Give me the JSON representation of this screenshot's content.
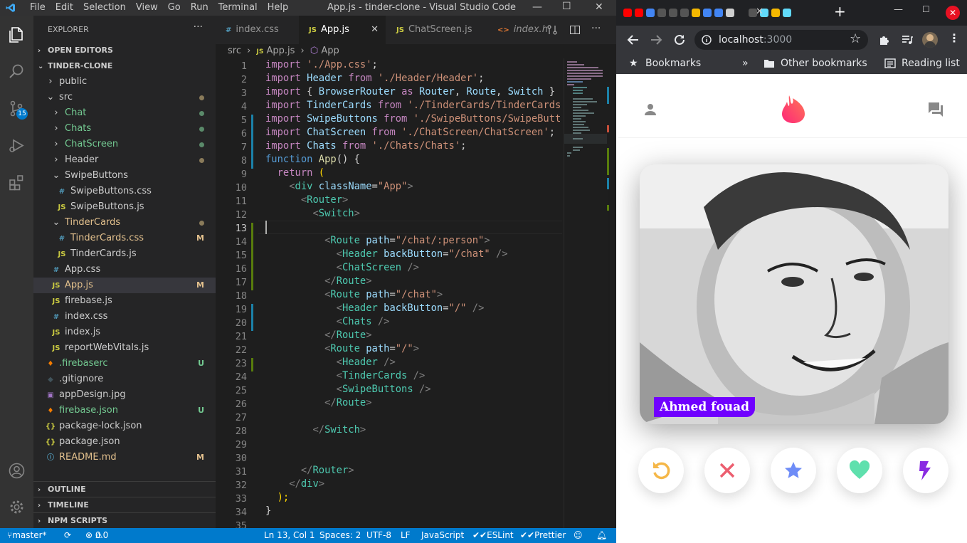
{
  "vscode": {
    "title": "App.js - tinder-clone - Visual Studio Code",
    "menu": [
      "File",
      "Edit",
      "Selection",
      "View",
      "Go",
      "Run",
      "Terminal",
      "Help"
    ],
    "activity_badge": "15",
    "explorer_header": "EXPLORER",
    "open_editors": "OPEN EDITORS",
    "project": "TINDER-CLONE",
    "tree": [
      {
        "label": "public",
        "kind": "folder",
        "indent": 1,
        "open": false
      },
      {
        "label": "src",
        "kind": "folder",
        "indent": 1,
        "open": true,
        "mark": "dot"
      },
      {
        "label": "Chat",
        "kind": "folder",
        "indent": 2,
        "open": false,
        "mark": "dot-green"
      },
      {
        "label": "Chats",
        "kind": "folder",
        "indent": 2,
        "open": false,
        "mark": "dot-green"
      },
      {
        "label": "ChatScreen",
        "kind": "folder",
        "indent": 2,
        "open": false,
        "mark": "dot-green"
      },
      {
        "label": "Header",
        "kind": "folder",
        "indent": 2,
        "open": false,
        "mark": "dot"
      },
      {
        "label": "SwipeButtons",
        "kind": "folder",
        "indent": 2,
        "open": true
      },
      {
        "label": "SwipeButtons.css",
        "kind": "css",
        "indent": 3
      },
      {
        "label": "SwipeButtons.js",
        "kind": "js",
        "indent": 3
      },
      {
        "label": "TinderCards",
        "kind": "folder",
        "indent": 2,
        "open": true,
        "mark": "dot",
        "color": "#e2c08d"
      },
      {
        "label": "TinderCards.css",
        "kind": "css",
        "indent": 3,
        "badge": "M",
        "color": "#e2c08d"
      },
      {
        "label": "TinderCards.js",
        "kind": "js",
        "indent": 3
      },
      {
        "label": "App.css",
        "kind": "css",
        "indent": 2
      },
      {
        "label": "App.js",
        "kind": "js",
        "indent": 2,
        "badge": "M",
        "color": "#e2c08d",
        "selected": true
      },
      {
        "label": "firebase.js",
        "kind": "js",
        "indent": 2
      },
      {
        "label": "index.css",
        "kind": "css",
        "indent": 2
      },
      {
        "label": "index.js",
        "kind": "js",
        "indent": 2
      },
      {
        "label": "reportWebVitals.js",
        "kind": "js",
        "indent": 2
      },
      {
        "label": ".firebaserc",
        "kind": "fire",
        "indent": 1,
        "badge": "U",
        "color": "#73c991"
      },
      {
        "label": ".gitignore",
        "kind": "git",
        "indent": 1
      },
      {
        "label": "appDesign.jpg",
        "kind": "img",
        "indent": 1
      },
      {
        "label": "firebase.json",
        "kind": "fire",
        "indent": 1,
        "badge": "U",
        "color": "#73c991"
      },
      {
        "label": "package-lock.json",
        "kind": "json",
        "indent": 1
      },
      {
        "label": "package.json",
        "kind": "json",
        "indent": 1
      },
      {
        "label": "README.md",
        "kind": "md",
        "indent": 1,
        "badge": "M",
        "color": "#e2c08d"
      }
    ],
    "outline": "OUTLINE",
    "timeline": "TIMELINE",
    "npm_scripts": "NPM SCRIPTS",
    "tabs": [
      {
        "label": "index.css",
        "icon": "#",
        "active": false
      },
      {
        "label": "App.js",
        "icon": "JS",
        "active": true
      },
      {
        "label": "ChatScreen.js",
        "icon": "JS",
        "active": false
      },
      {
        "label": "index.h",
        "icon": "<>",
        "active": false
      }
    ],
    "breadcrumb": [
      "src",
      "App.js",
      "App"
    ],
    "code": [
      [
        [
          "import ",
          "k"
        ],
        [
          "'./App.css'",
          "s"
        ],
        [
          ";",
          "p"
        ]
      ],
      [
        [
          "import ",
          "k"
        ],
        [
          "Header ",
          "v"
        ],
        [
          "from ",
          "k"
        ],
        [
          "'./Header/Header'",
          "s"
        ],
        [
          ";",
          "p"
        ]
      ],
      [
        [
          "import ",
          "k"
        ],
        [
          "{ ",
          "p"
        ],
        [
          "BrowserRouter ",
          "v"
        ],
        [
          "as ",
          "k"
        ],
        [
          "Router",
          "v"
        ],
        [
          ", ",
          "p"
        ],
        [
          "Route",
          "v"
        ],
        [
          ", ",
          "p"
        ],
        [
          "Switch ",
          "v"
        ],
        [
          "}",
          "p"
        ]
      ],
      [
        [
          "import ",
          "k"
        ],
        [
          "TinderCards ",
          "v"
        ],
        [
          "from ",
          "k"
        ],
        [
          "'./TinderCards/TinderCards",
          "s"
        ]
      ],
      [
        [
          "import ",
          "k"
        ],
        [
          "SwipeButtons ",
          "v"
        ],
        [
          "from ",
          "k"
        ],
        [
          "'./SwipeButtons/SwipeButt",
          "s"
        ]
      ],
      [
        [
          "import ",
          "k"
        ],
        [
          "ChatScreen ",
          "v"
        ],
        [
          "from ",
          "k"
        ],
        [
          "'./ChatScreen/ChatScreen'",
          "s"
        ],
        [
          ";",
          "p"
        ]
      ],
      [
        [
          "import ",
          "k"
        ],
        [
          "Chats ",
          "v"
        ],
        [
          "from ",
          "k"
        ],
        [
          "'./Chats/Chats'",
          "s"
        ],
        [
          ";",
          "p"
        ]
      ],
      [
        [
          "function ",
          "b"
        ],
        [
          "App",
          "f"
        ],
        [
          "() {",
          "p"
        ]
      ],
      [
        [
          "  return ",
          "k"
        ],
        [
          "(",
          "y"
        ]
      ],
      [
        [
          "    <",
          "g"
        ],
        [
          "div ",
          "t"
        ],
        [
          "className",
          "a"
        ],
        [
          "=",
          "p"
        ],
        [
          "\"App\"",
          "s"
        ],
        [
          ">",
          "g"
        ]
      ],
      [
        [
          "      <",
          "g"
        ],
        [
          "Router",
          "t"
        ],
        [
          ">",
          "g"
        ]
      ],
      [
        [
          "        <",
          "g"
        ],
        [
          "Switch",
          "t"
        ],
        [
          ">",
          "g"
        ]
      ],
      [
        [
          "",
          "p"
        ]
      ],
      [
        [
          "          <",
          "g"
        ],
        [
          "Route ",
          "t"
        ],
        [
          "path",
          "a"
        ],
        [
          "=",
          "p"
        ],
        [
          "\"/chat/:person\"",
          "s"
        ],
        [
          ">",
          "g"
        ]
      ],
      [
        [
          "            <",
          "g"
        ],
        [
          "Header ",
          "t"
        ],
        [
          "backButton",
          "a"
        ],
        [
          "=",
          "p"
        ],
        [
          "\"/chat\" ",
          "s"
        ],
        [
          "/>",
          "g"
        ]
      ],
      [
        [
          "            <",
          "g"
        ],
        [
          "ChatScreen ",
          "t"
        ],
        [
          "/>",
          "g"
        ]
      ],
      [
        [
          "          </",
          "g"
        ],
        [
          "Route",
          "t"
        ],
        [
          ">",
          "g"
        ]
      ],
      [
        [
          "          <",
          "g"
        ],
        [
          "Route ",
          "t"
        ],
        [
          "path",
          "a"
        ],
        [
          "=",
          "p"
        ],
        [
          "\"/chat\"",
          "s"
        ],
        [
          ">",
          "g"
        ]
      ],
      [
        [
          "            <",
          "g"
        ],
        [
          "Header ",
          "t"
        ],
        [
          "backButton",
          "a"
        ],
        [
          "=",
          "p"
        ],
        [
          "\"/\" ",
          "s"
        ],
        [
          "/>",
          "g"
        ]
      ],
      [
        [
          "            <",
          "g"
        ],
        [
          "Chats ",
          "t"
        ],
        [
          "/>",
          "g"
        ]
      ],
      [
        [
          "          </",
          "g"
        ],
        [
          "Route",
          "t"
        ],
        [
          ">",
          "g"
        ]
      ],
      [
        [
          "          <",
          "g"
        ],
        [
          "Route ",
          "t"
        ],
        [
          "path",
          "a"
        ],
        [
          "=",
          "p"
        ],
        [
          "\"/\"",
          "s"
        ],
        [
          ">",
          "g"
        ]
      ],
      [
        [
          "            <",
          "g"
        ],
        [
          "Header ",
          "t"
        ],
        [
          "/>",
          "g"
        ]
      ],
      [
        [
          "            <",
          "g"
        ],
        [
          "TinderCards ",
          "t"
        ],
        [
          "/>",
          "g"
        ]
      ],
      [
        [
          "            <",
          "g"
        ],
        [
          "SwipeButtons ",
          "t"
        ],
        [
          "/>",
          "g"
        ]
      ],
      [
        [
          "          </",
          "g"
        ],
        [
          "Route",
          "t"
        ],
        [
          ">",
          "g"
        ]
      ],
      [
        [
          "",
          "p"
        ]
      ],
      [
        [
          "        </",
          "g"
        ],
        [
          "Switch",
          "t"
        ],
        [
          ">",
          "g"
        ]
      ],
      [
        [
          "",
          "p"
        ]
      ],
      [
        [
          "",
          "p"
        ]
      ],
      [
        [
          "      </",
          "g"
        ],
        [
          "Router",
          "t"
        ],
        [
          ">",
          "g"
        ]
      ],
      [
        [
          "    </",
          "g"
        ],
        [
          "div",
          "t"
        ],
        [
          ">",
          "g"
        ]
      ],
      [
        [
          "  );",
          "y"
        ]
      ],
      [
        [
          "}",
          "p"
        ]
      ],
      [
        [
          "",
          "p"
        ]
      ]
    ],
    "current_line": 13,
    "status": {
      "branch": "master*",
      "problems_errors": "0",
      "problems_warnings": "0",
      "position": "Ln 13, Col 1",
      "spaces": "Spaces: 2",
      "encoding": "UTF-8",
      "eol": "LF",
      "language": "JavaScript",
      "eslint": "ESLint",
      "prettier": "Prettier"
    }
  },
  "browser": {
    "url_host": "localhost",
    "url_port": ":3000",
    "bookmarks_label": "Bookmarks",
    "other_bookmarks": "Other bookmarks",
    "reading_list": "Reading list",
    "card_name": "Ahmed fouad"
  },
  "colors": {
    "accent": "#007acc",
    "tinder_pink": "#fe3c72",
    "rewind": "#f5b748",
    "nope": "#ec5e6f",
    "superlike": "#62b4f9",
    "like": "#76e2b3",
    "boost": "#915dd1",
    "nametag": "#7000ff"
  }
}
